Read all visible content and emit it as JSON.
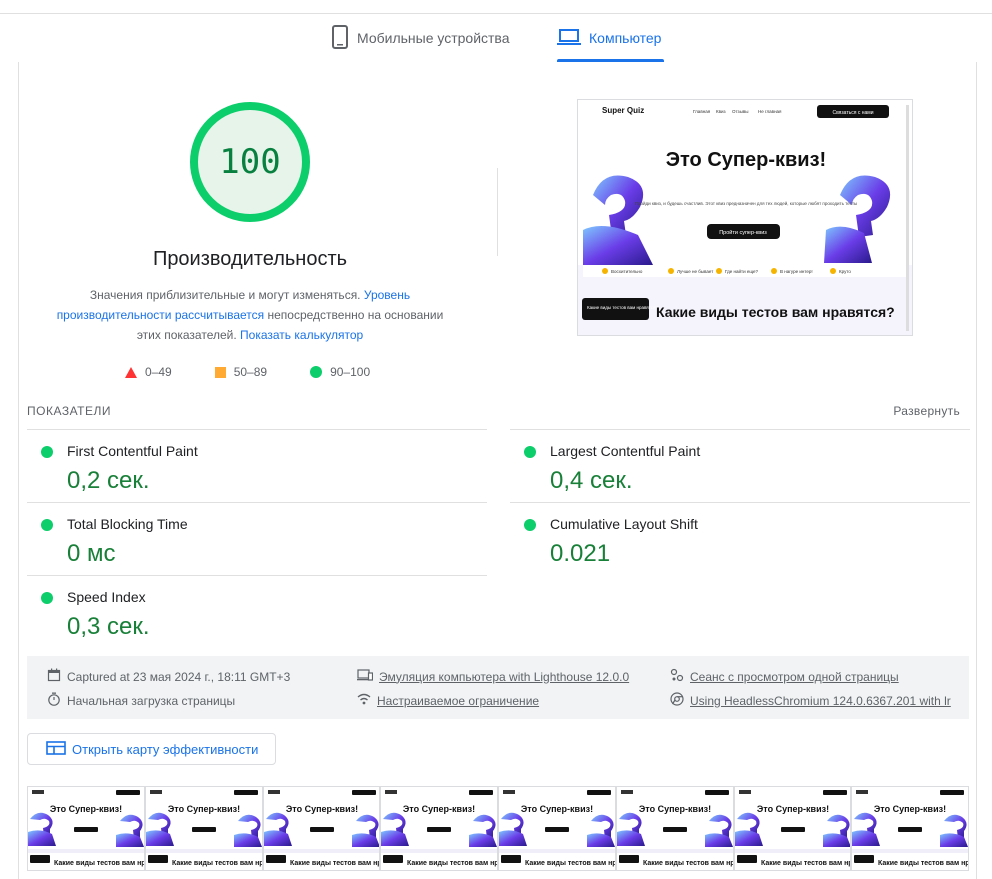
{
  "tabs": [
    {
      "label": "Мобильные устройства",
      "icon": "smartphone-icon",
      "selected": false
    },
    {
      "label": "Компьютер",
      "icon": "laptop-icon",
      "selected": true
    }
  ],
  "score": {
    "value": "100",
    "title": "Производительность",
    "desc_part1": "Значения приблизительные и могут изменяться.",
    "desc_link1": "Уровень производительности рассчитывается",
    "desc_part2": "непосредственно на основании этих показателей.",
    "desc_link2": "Показать калькулятор",
    "gauge_color": "#0cce6b"
  },
  "legend": {
    "fail": "0–49",
    "average": "50–89",
    "pass": "90–100",
    "colors": {
      "fail": "#ff3333",
      "average": "#ffaa33",
      "pass": "#0cce6b"
    }
  },
  "screenshot": {
    "logo": "Super Quiz",
    "nav": [
      "Главная",
      "Квиз",
      "Отзывы",
      "Не главная"
    ],
    "cta": "Связаться с нами",
    "headline": "Это Супер-квиз!",
    "text": "Пройди квиз, и будешь счастлив. Этот квиз предназначен для тех людей, которые любят проходить тесты",
    "button": "Пройти супер-квиз",
    "reactions": [
      "Восхитительно",
      "Лучше не бывает",
      "Где найти еще?",
      "В нагуре интер!",
      "Круто"
    ],
    "card_label": "Какие виды тестов вам нравятся?",
    "heading2": "Какие виды тестов вам нравятся?"
  },
  "metrics": {
    "section_label": "ПОКАЗАТЕЛИ",
    "expand_label": "Развернуть",
    "items": [
      {
        "name": "First Contentful Paint",
        "value": "0,2 сек."
      },
      {
        "name": "Largest Contentful Paint",
        "value": "0,4 сек."
      },
      {
        "name": "Total Blocking Time",
        "value": "0 мс"
      },
      {
        "name": "Cumulative Layout Shift",
        "value": "0.021"
      },
      {
        "name": "Speed Index",
        "value": "0,3 сек."
      }
    ],
    "status_color": "#0cce6b",
    "value_color": "#188038"
  },
  "info": {
    "captured": "Captured at 23 мая 2024 г., 18:11 GMT+3",
    "load": "Начальная загрузка страницы",
    "emulation": "Эмуляция компьютера with Lighthouse 12.0.0",
    "throttling": "Настраиваемое ограничение",
    "session": "Сеанс с просмотром одной страницы",
    "browser": "Using HeadlessChromium 124.0.6367.201 with lr"
  },
  "treemap_button": "Открыть карту эффективности",
  "filmstrip": {
    "frame_count": 8,
    "headline": "Это Супер-квиз!",
    "heading2": "Какие виды тестов вам нравятся?"
  }
}
